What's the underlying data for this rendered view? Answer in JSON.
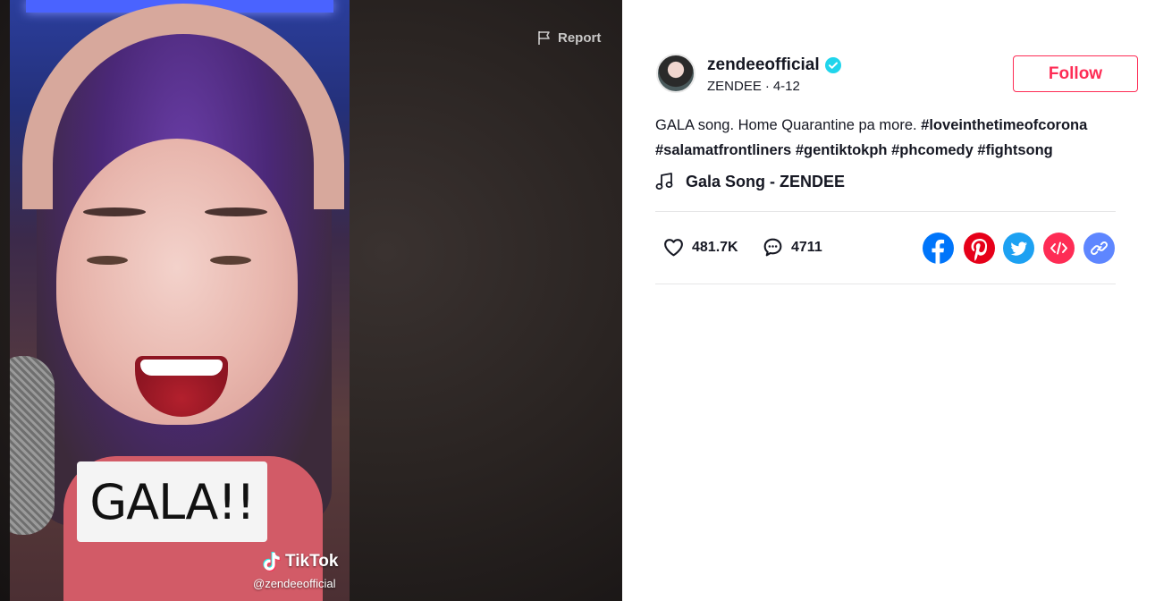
{
  "video": {
    "overlay_text": "GALA!!",
    "watermark_brand": "TikTok",
    "watermark_handle": "@zendeeofficial",
    "report_label": "Report"
  },
  "author": {
    "username": "zendeeofficial",
    "display_name": "ZENDEE",
    "separator": "·",
    "date": "4-12",
    "verified": true,
    "follow_label": "Follow"
  },
  "caption": {
    "text": "GALA song. Home Quarantine pa more.",
    "hashtags": [
      "#loveinthetimeofcorona",
      "#salamatfrontliners",
      "#gentiktokph",
      "#phcomedy",
      "#fightsong"
    ]
  },
  "music": {
    "title": "Gala Song - ZENDEE",
    "icon": "music-note-icon"
  },
  "stats": {
    "likes": "481.7K",
    "comments": "4711"
  },
  "share": {
    "items": [
      "facebook-icon",
      "pinterest-icon",
      "twitter-icon",
      "embed-icon",
      "link-icon"
    ]
  },
  "colors": {
    "accent": "#fe2c55",
    "verified": "#20d5ec",
    "facebook": "#0075fa",
    "pinterest": "#e60019",
    "twitter": "#1da1f2",
    "embed": "#fe2c55",
    "link": "#5e86ff"
  }
}
